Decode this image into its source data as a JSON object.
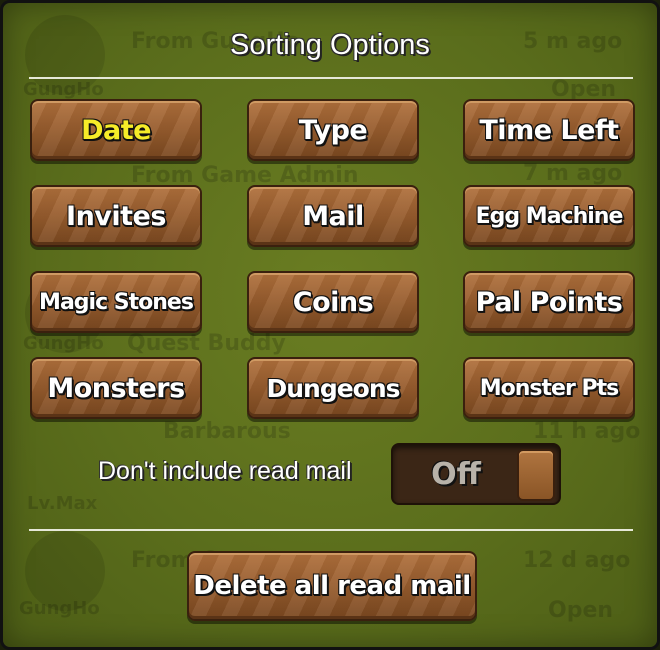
{
  "dialog": {
    "title": "Sorting Options"
  },
  "sort_buttons": [
    {
      "label": "Date",
      "selected": true
    },
    {
      "label": "Type"
    },
    {
      "label": "Time Left"
    },
    {
      "label": "Invites"
    },
    {
      "label": "Mail"
    },
    {
      "label": "Egg Machine"
    },
    {
      "label": "Magic Stones"
    },
    {
      "label": "Coins"
    },
    {
      "label": "Pal Points"
    },
    {
      "label": "Monsters"
    },
    {
      "label": "Dungeons"
    },
    {
      "label": "Monster Pts"
    }
  ],
  "read_mail_option": {
    "label": "Don't include read mail",
    "toggle_state": "Off"
  },
  "delete_button": {
    "label": "Delete all read mail"
  },
  "background_text": {
    "sender1": "From GungHo",
    "time1": "5 m ago",
    "brand1": "GungHo",
    "open1": "Open",
    "sender2": "From Game Admin",
    "time2": "7 m ago",
    "sender3": "Quest Buddy",
    "brand2": "GungHo",
    "sender4": "Barbarous",
    "time4": "11 h ago",
    "brand4": "Lv.Max",
    "sender5": "From Ques",
    "time5": "12 d ago",
    "brand5": "GungHo",
    "open5": "Open"
  },
  "colors": {
    "panel_green": "#5b6e1c",
    "button_brown": "#945a2c",
    "selected_text": "#f6ec28"
  }
}
